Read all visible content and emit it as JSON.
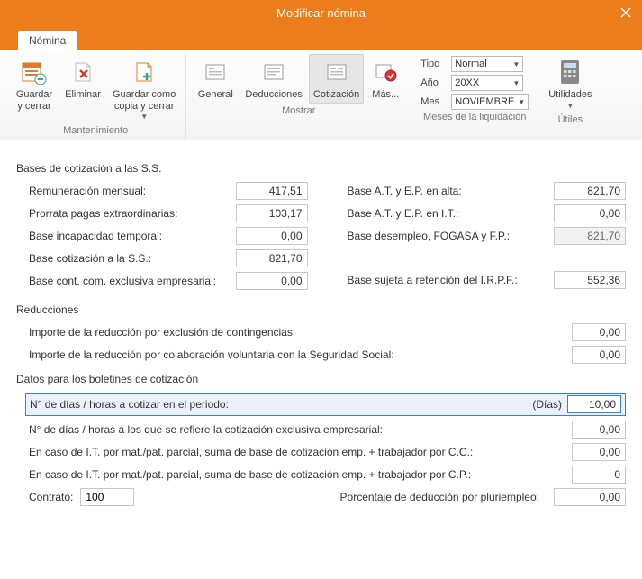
{
  "window": {
    "title": "Modificar nómina"
  },
  "tab": {
    "label": "Nómina"
  },
  "ribbon": {
    "mantenimiento": {
      "label": "Mantenimiento",
      "guardar_cerrar": "Guardar\ny cerrar",
      "eliminar": "Eliminar",
      "guardar_como": "Guardar como\ncopia y cerrar"
    },
    "mostrar": {
      "label": "Mostrar",
      "general": "General",
      "deducciones": "Deducciones",
      "cotizacion": "Cotización",
      "mas": "Más..."
    },
    "meses": {
      "label": "Meses de la liquidación",
      "tipo_l": "Tipo",
      "tipo_v": "Normal",
      "ano_l": "Año",
      "ano_v": "20XX",
      "mes_l": "Mes",
      "mes_v": "NOVIEMBRE"
    },
    "utiles": {
      "label": "Útiles",
      "utilidades": "Utilidades"
    }
  },
  "bases": {
    "heading": "Bases de cotización a las S.S.",
    "rem_mensual_l": "Remuneración mensual:",
    "rem_mensual_v": "417,51",
    "prorrata_l": "Prorrata pagas extraordinarias:",
    "prorrata_v": "103,17",
    "it_l": "Base incapacidad temporal:",
    "it_v": "0,00",
    "cot_ss_l": "Base cotización a la S.S.:",
    "cot_ss_v": "821,70",
    "exc_emp_l": "Base cont. com. exclusiva empresarial:",
    "exc_emp_v": "0,00",
    "at_alta_l": "Base A.T. y E.P. en alta:",
    "at_alta_v": "821,70",
    "at_it_l": "Base A.T. y E.P. en I.T.:",
    "at_it_v": "0,00",
    "desem_l": "Base desempleo, FOGASA y F.P.:",
    "desem_v": "821,70",
    "irpf_l": "Base sujeta a retención del I.R.P.F.:",
    "irpf_v": "552,36"
  },
  "reducciones": {
    "heading": "Reducciones",
    "r1_l": "Importe de la reducción por exclusión de contingencias:",
    "r1_v": "0,00",
    "r2_l": "Importe de la reducción por colaboración voluntaria con la Seguridad Social:",
    "r2_v": "0,00"
  },
  "boletines": {
    "heading": "Datos para los boletines de cotización",
    "dias_l": "N° de días / horas a cotizar en el periodo:",
    "dias_unit": "(Días)",
    "dias_v": "10,00",
    "excl_l": "N° de días / horas a los que se refiere la cotización exclusiva empresarial:",
    "excl_v": "0,00",
    "cc_l": "En caso de I.T. por mat./pat. parcial, suma de base de cotización emp. + trabajador por C.C.:",
    "cc_v": "0,00",
    "cp_l": "En caso de I.T. por mat./pat. parcial, suma de base de cotización emp. + trabajador por C.P.:",
    "cp_v": "0",
    "contrato_l": "Contrato:",
    "contrato_v": "100",
    "pluri_l": "Porcentaje de deducción por pluriempleo:",
    "pluri_v": "0,00"
  }
}
